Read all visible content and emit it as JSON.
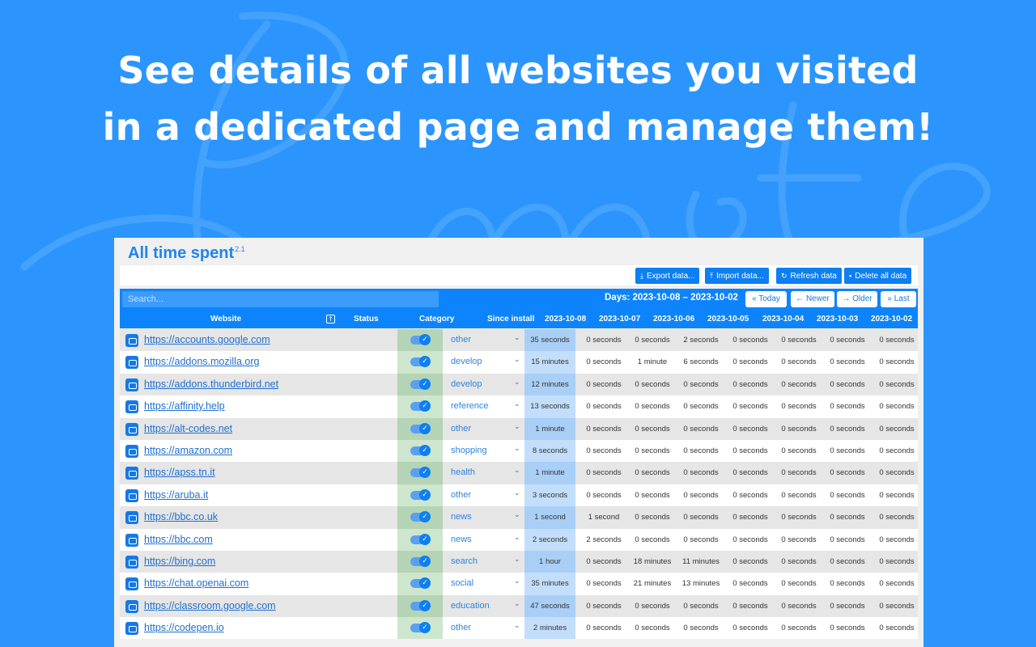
{
  "headline": {
    "line1": "See details of all websites you visited",
    "line2": "in a dedicated page and manage them!"
  },
  "panel": {
    "title": "All time spent",
    "version": "2.1",
    "toolbar": {
      "export_label": "Export data...",
      "import_label": "Import data...",
      "refresh_label": "Refresh data",
      "delete_label": "Delete all data"
    },
    "search_placeholder": "Search...",
    "days_range": "Days: 2023-10-08 – 2023-10-02",
    "nav": {
      "today": "Today",
      "newer": "Newer",
      "older": "Older",
      "last": "Last"
    },
    "columns": [
      "Website",
      "Status",
      "Category",
      "Since install",
      "2023-10-08",
      "2023-10-07",
      "2023-10-06",
      "2023-10-05",
      "2023-10-04",
      "2023-10-03",
      "2023-10-02"
    ],
    "rows": [
      {
        "site": "https://accounts.google.com",
        "category": "other",
        "since": "35 seconds",
        "days": [
          "0 seconds",
          "0 seconds",
          "2 seconds",
          "0 seconds",
          "0 seconds",
          "0 seconds",
          "0 seconds"
        ]
      },
      {
        "site": "https://addons.mozilla.org",
        "category": "develop",
        "since": "15 minutes",
        "days": [
          "0 seconds",
          "1 minute",
          "6 seconds",
          "0 seconds",
          "0 seconds",
          "0 seconds",
          "0 seconds"
        ]
      },
      {
        "site": "https://addons.thunderbird.net",
        "category": "develop",
        "since": "12 minutes",
        "days": [
          "0 seconds",
          "0 seconds",
          "0 seconds",
          "0 seconds",
          "0 seconds",
          "0 seconds",
          "0 seconds"
        ]
      },
      {
        "site": "https://affinity.help",
        "category": "reference",
        "since": "13 seconds",
        "days": [
          "0 seconds",
          "0 seconds",
          "0 seconds",
          "0 seconds",
          "0 seconds",
          "0 seconds",
          "0 seconds"
        ]
      },
      {
        "site": "https://alt-codes.net",
        "category": "other",
        "since": "1 minute",
        "days": [
          "0 seconds",
          "0 seconds",
          "0 seconds",
          "0 seconds",
          "0 seconds",
          "0 seconds",
          "0 seconds"
        ]
      },
      {
        "site": "https://amazon.com",
        "category": "shopping",
        "since": "8 seconds",
        "days": [
          "0 seconds",
          "0 seconds",
          "0 seconds",
          "0 seconds",
          "0 seconds",
          "0 seconds",
          "0 seconds"
        ]
      },
      {
        "site": "https://apss.tn.it",
        "category": "health",
        "since": "1 minute",
        "days": [
          "0 seconds",
          "0 seconds",
          "0 seconds",
          "0 seconds",
          "0 seconds",
          "0 seconds",
          "0 seconds"
        ]
      },
      {
        "site": "https://aruba.it",
        "category": "other",
        "since": "3 seconds",
        "days": [
          "0 seconds",
          "0 seconds",
          "0 seconds",
          "0 seconds",
          "0 seconds",
          "0 seconds",
          "0 seconds"
        ]
      },
      {
        "site": "https://bbc.co.uk",
        "category": "news",
        "since": "1 second",
        "days": [
          "1 second",
          "0 seconds",
          "0 seconds",
          "0 seconds",
          "0 seconds",
          "0 seconds",
          "0 seconds"
        ]
      },
      {
        "site": "https://bbc.com",
        "category": "news",
        "since": "2 seconds",
        "days": [
          "2 seconds",
          "0 seconds",
          "0 seconds",
          "0 seconds",
          "0 seconds",
          "0 seconds",
          "0 seconds"
        ]
      },
      {
        "site": "https://bing.com",
        "category": "search",
        "since": "1 hour",
        "days": [
          "0 seconds",
          "18 minutes",
          "11 minutes",
          "0 seconds",
          "0 seconds",
          "0 seconds",
          "0 seconds"
        ]
      },
      {
        "site": "https://chat.openai.com",
        "category": "social",
        "since": "35 minutes",
        "days": [
          "0 seconds",
          "21 minutes",
          "13 minutes",
          "0 seconds",
          "0 seconds",
          "0 seconds",
          "0 seconds"
        ]
      },
      {
        "site": "https://classroom.google.com",
        "category": "education",
        "since": "47 seconds",
        "days": [
          "0 seconds",
          "0 seconds",
          "0 seconds",
          "0 seconds",
          "0 seconds",
          "0 seconds",
          "0 seconds"
        ]
      },
      {
        "site": "https://codepen.io",
        "category": "other",
        "since": "2 minutes",
        "days": [
          "0 seconds",
          "0 seconds",
          "0 seconds",
          "0 seconds",
          "0 seconds",
          "0 seconds",
          "0 seconds"
        ]
      }
    ]
  },
  "icons": {
    "export": "download-icon",
    "import": "upload-icon",
    "refresh": "refresh-icon",
    "delete": "trash-icon",
    "today": "double-chevron-left-icon",
    "newer": "arrow-left-icon",
    "older": "arrow-right-icon",
    "last": "double-chevron-right-icon",
    "favicon": "favicon-icon",
    "status": "check-icon",
    "category": "chevron-down-icon",
    "sort": "sort-icon"
  },
  "colors": {
    "background": "#2b95fd",
    "accent": "#0d84fb",
    "link": "#1f6fcf"
  }
}
